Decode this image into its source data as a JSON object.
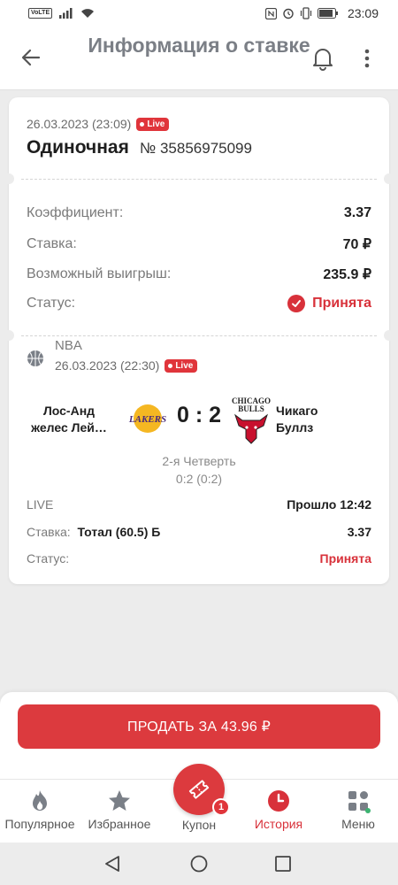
{
  "status_bar": {
    "network_badge": "VoLTE",
    "time": "23:09",
    "icons": [
      "signal-icon",
      "wifi-icon",
      "nfc-icon",
      "alarm-icon",
      "vibrate-icon",
      "battery-icon"
    ]
  },
  "header": {
    "title": "Информация о ставке",
    "back_icon": "arrow-left-icon",
    "bell_icon": "bell-icon",
    "menu_icon": "kebab-icon"
  },
  "bet": {
    "date": "26.03.2023 (23:09)",
    "live_label": "Live",
    "type": "Одиночная",
    "number": "№ 35856975099",
    "coefficient_label": "Коэффициент:",
    "coefficient": "3.37",
    "stake_label": "Ставка:",
    "stake": "70 ₽",
    "win_label": "Возможный выигрыш:",
    "win": "235.9 ₽",
    "status_label": "Статус:",
    "status": "Принята"
  },
  "event": {
    "league": "NBA",
    "date": "26.03.2023 (22:30)",
    "live_label": "Live",
    "home_team": "Лос-Анд желес Лей…",
    "away_team": "Чикаго Буллз",
    "home_logo_text": "LAKERS",
    "away_logo_text_top": "CHICAGO",
    "away_logo_text_bottom": "BULLS",
    "score": "0 : 2",
    "period": "2-я Четверть",
    "period_score": "0:2 (0:2)",
    "live_text": "LIVE",
    "elapsed": "Прошло 12:42",
    "stake_label": "Ставка:",
    "stake_market": "Тотал (60.5) Б",
    "stake_coef": "3.37",
    "status_label": "Статус:",
    "status": "Принята"
  },
  "sell": {
    "label": "ПРОДАТЬ ЗА 43.96 ₽"
  },
  "nav": {
    "items": [
      {
        "label": "Популярное",
        "icon": "flame-icon"
      },
      {
        "label": "Избранное",
        "icon": "star-icon"
      },
      {
        "label": "Купон",
        "icon": "ticket-icon",
        "badge": "1"
      },
      {
        "label": "История",
        "icon": "clock-icon",
        "active": true
      },
      {
        "label": "Меню",
        "icon": "grid-icon"
      }
    ]
  },
  "colors": {
    "accent": "#dc3a3e",
    "title_gray": "#7b7f86",
    "background": "#ececec"
  }
}
